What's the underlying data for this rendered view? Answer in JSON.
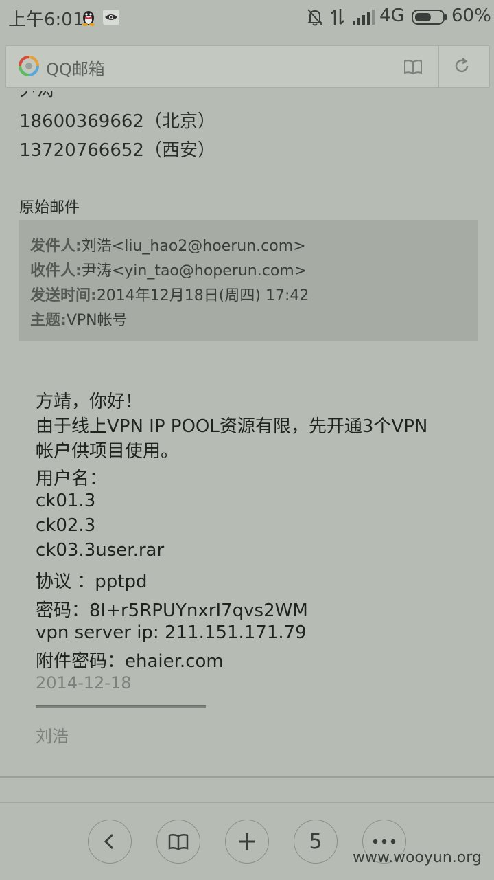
{
  "status_bar": {
    "time": "上午6:01",
    "network": "4G",
    "battery": "60%",
    "battery_level": 0.6
  },
  "address_bar": {
    "title": "QQ邮箱"
  },
  "email": {
    "clipped_name": "尹涛",
    "phones": [
      "18600369662（北京）",
      "13720766652（西安）"
    ],
    "original_label": "原始邮件",
    "header": {
      "from_key": "发件人:",
      "from_val": "刘浩<liu_hao2@hoerun.com>",
      "to_key": "收件人:",
      "to_val": "尹涛<yin_tao@hoperun.com>",
      "time_key": "发送时间:",
      "time_val": "2014年12月18日(周四)  17:42",
      "subject_key": "主题:",
      "subject_val": "VPN帐号"
    },
    "body": [
      "方靖，你好！",
      "由于线上VPN  IP  POOL资源有限，先开通3个VPN",
      "帐户供项目使用。",
      "用户名：",
      "ck01.3",
      "ck02.3",
      "ck03.3user.rar",
      "协议 ：pptpd",
      "密码：8I+r5RPUYnxrI7qvs2WM",
      "vpn server ip: 211.151.171.79",
      "附件密码：ehaier.com"
    ],
    "date": "2014-12-18",
    "signature": "刘浩"
  },
  "toolbar": {
    "tab_count": "5"
  },
  "watermark": "www.wooyun.org"
}
